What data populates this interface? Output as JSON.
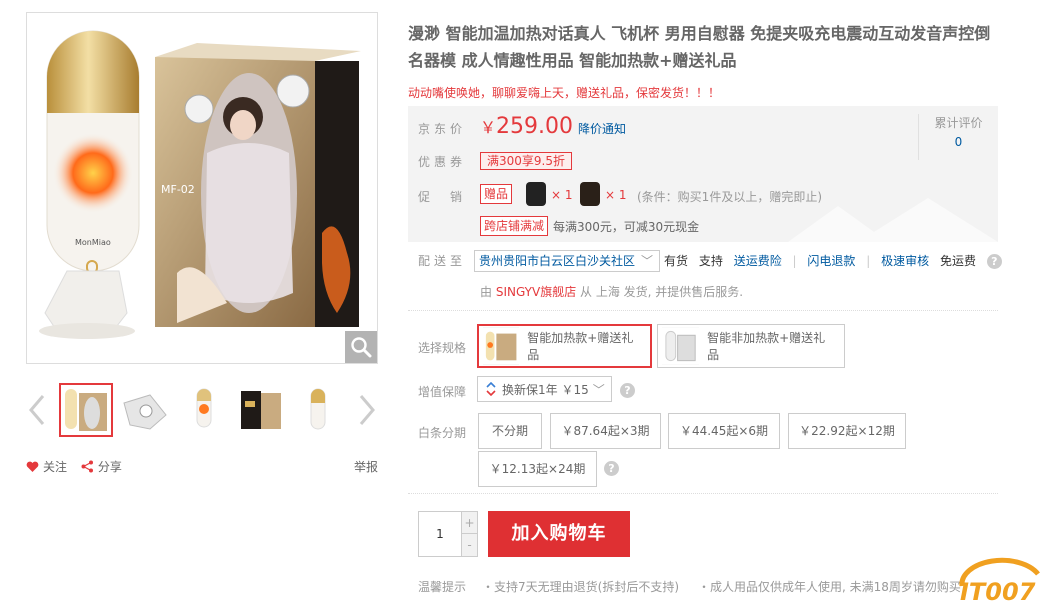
{
  "gallery": {
    "main_box_text": "MF-02",
    "brand_on_device": "MonMiao",
    "thumbnails": [
      "thumb-1",
      "thumb-2",
      "thumb-3",
      "thumb-4",
      "thumb-5"
    ],
    "follow_label": "关注",
    "share_label": "分享",
    "report_label": "举报"
  },
  "product": {
    "title": "漫渺 智能加温加热对话真人 飞机杯 男用自慰器 免提夹吸充电震动互动发音声控倒名器模 成人情趣性用品 智能加热款+赠送礼品",
    "promo_line": "动动嘴使唤她，聊聊爱嗨上天，赠送礼品，保密发货！！！"
  },
  "summary": {
    "price_label": "京东价",
    "currency": "￥",
    "price": "259.00",
    "notify_label": "降价通知",
    "comment_label": "累计评价",
    "comment_count": "0",
    "coupon_label": "优惠券",
    "coupon_tag": "满300享9.5折",
    "promo_label": "促　销",
    "gift_tag": "赠品",
    "gift_qty_1": "× 1",
    "gift_qty_2": "× 1",
    "gift_condition": "(条件：购买1件及以上，赠完即止)",
    "shop_tag": "跨店铺满减",
    "shop_text": "每满300元，可减30元现金"
  },
  "shipping": {
    "label": "配送至",
    "address": "贵州贵阳市白云区白沙关社区",
    "stock": "有货",
    "support": "支持",
    "insurance": "送运费险",
    "flash_refund": "闪电退款",
    "fast_review": "极速审核",
    "free_ship": "免运费",
    "seller_prefix": "由",
    "seller_name": "SINGYV旗舰店",
    "seller_suffix": "从 上海 发货, 并提供售后服务."
  },
  "options": {
    "spec_label": "选择规格",
    "spec_1": "智能加热款+赠送礼品",
    "spec_2": "智能非加热款+赠送礼品",
    "warranty_label": "增值保障",
    "warranty_value": "换新保1年 ￥15",
    "installment_label": "白条分期",
    "installments": [
      "不分期",
      "￥87.64起×3期",
      "￥44.45起×6期",
      "￥22.92起×12期",
      "￥12.13起×24期"
    ]
  },
  "purchase": {
    "quantity": "1",
    "plus": "+",
    "minus": "-",
    "cart_label": "加入购物车",
    "tips_label": "温馨提示",
    "tip_1": "・支持7天无理由退货(拆封后不支持)",
    "tip_2": "・成人用品仅供成年人使用, 未满18周岁请勿购买"
  },
  "watermark": "IT007",
  "colors": {
    "accent_red": "#e4393c",
    "link_blue": "#005aa0",
    "summary_bg": "#f3f3f3"
  }
}
